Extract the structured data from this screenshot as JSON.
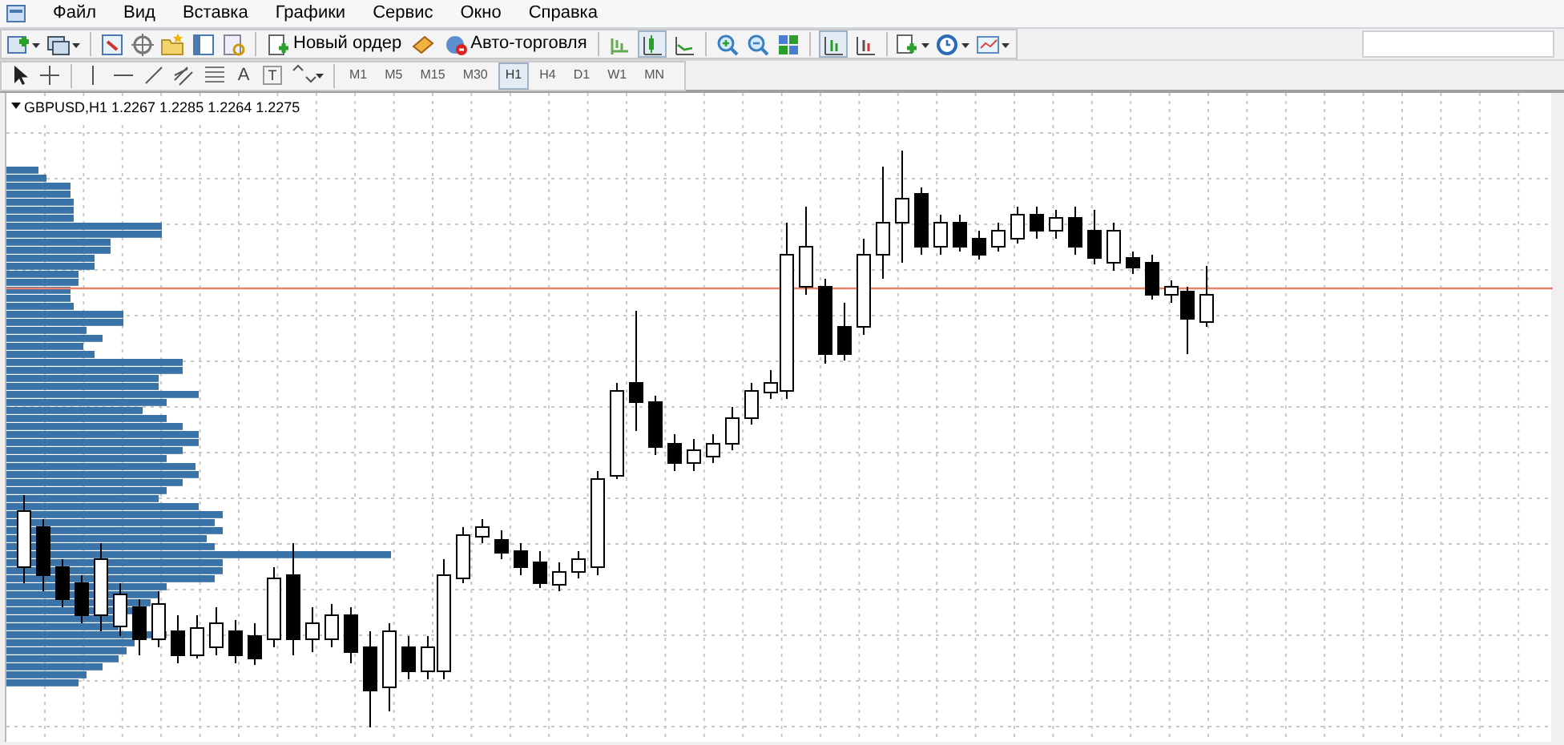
{
  "menu": [
    {
      "label": "Файл"
    },
    {
      "label": "Вид"
    },
    {
      "label": "Вставка"
    },
    {
      "label": "Графики"
    },
    {
      "label": "Сервис"
    },
    {
      "label": "Окно"
    },
    {
      "label": "Справка"
    }
  ],
  "toolbar": {
    "new_order": "Новый ордер",
    "autotrading": "Авто-торговля"
  },
  "draw_tools": {
    "text_label": "A",
    "text_box": "T"
  },
  "timeframes": [
    {
      "label": "M1",
      "selected": false
    },
    {
      "label": "M5",
      "selected": false
    },
    {
      "label": "M15",
      "selected": false
    },
    {
      "label": "M30",
      "selected": false
    },
    {
      "label": "H1",
      "selected": true
    },
    {
      "label": "H4",
      "selected": false
    },
    {
      "label": "D1",
      "selected": false
    },
    {
      "label": "W1",
      "selected": false
    },
    {
      "label": "MN",
      "selected": false
    }
  ],
  "chart": {
    "header": "GBPUSD,H1  1.2267 1.2285 1.2264 1.2275"
  }
}
